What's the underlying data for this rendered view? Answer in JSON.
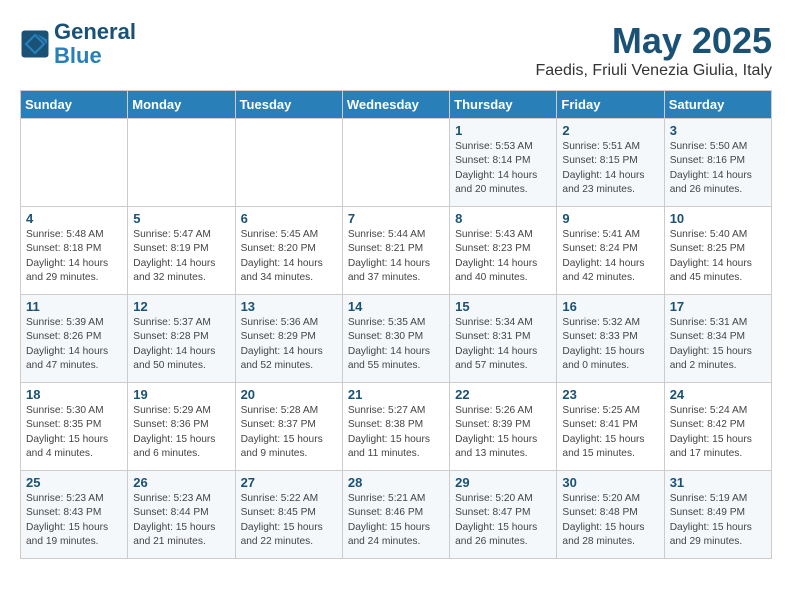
{
  "logo": {
    "line1": "General",
    "line2": "Blue"
  },
  "title": "May 2025",
  "location": "Faedis, Friuli Venezia Giulia, Italy",
  "days_of_week": [
    "Sunday",
    "Monday",
    "Tuesday",
    "Wednesday",
    "Thursday",
    "Friday",
    "Saturday"
  ],
  "weeks": [
    [
      {
        "day": "",
        "info": ""
      },
      {
        "day": "",
        "info": ""
      },
      {
        "day": "",
        "info": ""
      },
      {
        "day": "",
        "info": ""
      },
      {
        "day": "1",
        "info": "Sunrise: 5:53 AM\nSunset: 8:14 PM\nDaylight: 14 hours\nand 20 minutes."
      },
      {
        "day": "2",
        "info": "Sunrise: 5:51 AM\nSunset: 8:15 PM\nDaylight: 14 hours\nand 23 minutes."
      },
      {
        "day": "3",
        "info": "Sunrise: 5:50 AM\nSunset: 8:16 PM\nDaylight: 14 hours\nand 26 minutes."
      }
    ],
    [
      {
        "day": "4",
        "info": "Sunrise: 5:48 AM\nSunset: 8:18 PM\nDaylight: 14 hours\nand 29 minutes."
      },
      {
        "day": "5",
        "info": "Sunrise: 5:47 AM\nSunset: 8:19 PM\nDaylight: 14 hours\nand 32 minutes."
      },
      {
        "day": "6",
        "info": "Sunrise: 5:45 AM\nSunset: 8:20 PM\nDaylight: 14 hours\nand 34 minutes."
      },
      {
        "day": "7",
        "info": "Sunrise: 5:44 AM\nSunset: 8:21 PM\nDaylight: 14 hours\nand 37 minutes."
      },
      {
        "day": "8",
        "info": "Sunrise: 5:43 AM\nSunset: 8:23 PM\nDaylight: 14 hours\nand 40 minutes."
      },
      {
        "day": "9",
        "info": "Sunrise: 5:41 AM\nSunset: 8:24 PM\nDaylight: 14 hours\nand 42 minutes."
      },
      {
        "day": "10",
        "info": "Sunrise: 5:40 AM\nSunset: 8:25 PM\nDaylight: 14 hours\nand 45 minutes."
      }
    ],
    [
      {
        "day": "11",
        "info": "Sunrise: 5:39 AM\nSunset: 8:26 PM\nDaylight: 14 hours\nand 47 minutes."
      },
      {
        "day": "12",
        "info": "Sunrise: 5:37 AM\nSunset: 8:28 PM\nDaylight: 14 hours\nand 50 minutes."
      },
      {
        "day": "13",
        "info": "Sunrise: 5:36 AM\nSunset: 8:29 PM\nDaylight: 14 hours\nand 52 minutes."
      },
      {
        "day": "14",
        "info": "Sunrise: 5:35 AM\nSunset: 8:30 PM\nDaylight: 14 hours\nand 55 minutes."
      },
      {
        "day": "15",
        "info": "Sunrise: 5:34 AM\nSunset: 8:31 PM\nDaylight: 14 hours\nand 57 minutes."
      },
      {
        "day": "16",
        "info": "Sunrise: 5:32 AM\nSunset: 8:33 PM\nDaylight: 15 hours\nand 0 minutes."
      },
      {
        "day": "17",
        "info": "Sunrise: 5:31 AM\nSunset: 8:34 PM\nDaylight: 15 hours\nand 2 minutes."
      }
    ],
    [
      {
        "day": "18",
        "info": "Sunrise: 5:30 AM\nSunset: 8:35 PM\nDaylight: 15 hours\nand 4 minutes."
      },
      {
        "day": "19",
        "info": "Sunrise: 5:29 AM\nSunset: 8:36 PM\nDaylight: 15 hours\nand 6 minutes."
      },
      {
        "day": "20",
        "info": "Sunrise: 5:28 AM\nSunset: 8:37 PM\nDaylight: 15 hours\nand 9 minutes."
      },
      {
        "day": "21",
        "info": "Sunrise: 5:27 AM\nSunset: 8:38 PM\nDaylight: 15 hours\nand 11 minutes."
      },
      {
        "day": "22",
        "info": "Sunrise: 5:26 AM\nSunset: 8:39 PM\nDaylight: 15 hours\nand 13 minutes."
      },
      {
        "day": "23",
        "info": "Sunrise: 5:25 AM\nSunset: 8:41 PM\nDaylight: 15 hours\nand 15 minutes."
      },
      {
        "day": "24",
        "info": "Sunrise: 5:24 AM\nSunset: 8:42 PM\nDaylight: 15 hours\nand 17 minutes."
      }
    ],
    [
      {
        "day": "25",
        "info": "Sunrise: 5:23 AM\nSunset: 8:43 PM\nDaylight: 15 hours\nand 19 minutes."
      },
      {
        "day": "26",
        "info": "Sunrise: 5:23 AM\nSunset: 8:44 PM\nDaylight: 15 hours\nand 21 minutes."
      },
      {
        "day": "27",
        "info": "Sunrise: 5:22 AM\nSunset: 8:45 PM\nDaylight: 15 hours\nand 22 minutes."
      },
      {
        "day": "28",
        "info": "Sunrise: 5:21 AM\nSunset: 8:46 PM\nDaylight: 15 hours\nand 24 minutes."
      },
      {
        "day": "29",
        "info": "Sunrise: 5:20 AM\nSunset: 8:47 PM\nDaylight: 15 hours\nand 26 minutes."
      },
      {
        "day": "30",
        "info": "Sunrise: 5:20 AM\nSunset: 8:48 PM\nDaylight: 15 hours\nand 28 minutes."
      },
      {
        "day": "31",
        "info": "Sunrise: 5:19 AM\nSunset: 8:49 PM\nDaylight: 15 hours\nand 29 minutes."
      }
    ]
  ]
}
